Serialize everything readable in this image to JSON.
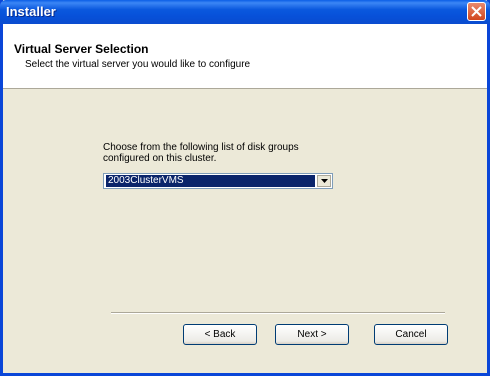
{
  "window": {
    "title": "Installer"
  },
  "header": {
    "title": "Virtual Server Selection",
    "subtitle": "Select the virtual server you would like to configure"
  },
  "main": {
    "prompt_line1": "Choose from the following list of disk groups",
    "prompt_line2": "configured on this cluster.",
    "dropdown": {
      "selected": "2003ClusterVMS"
    }
  },
  "buttons": {
    "back": "< Back",
    "next": "Next >",
    "cancel": "Cancel"
  },
  "icons": {
    "close": "close-icon",
    "dropdown": "chevron-down-icon"
  },
  "colors": {
    "titlebar": "#0a58de",
    "selection": "#0a246a",
    "dialog_bg": "#ece9d8"
  }
}
